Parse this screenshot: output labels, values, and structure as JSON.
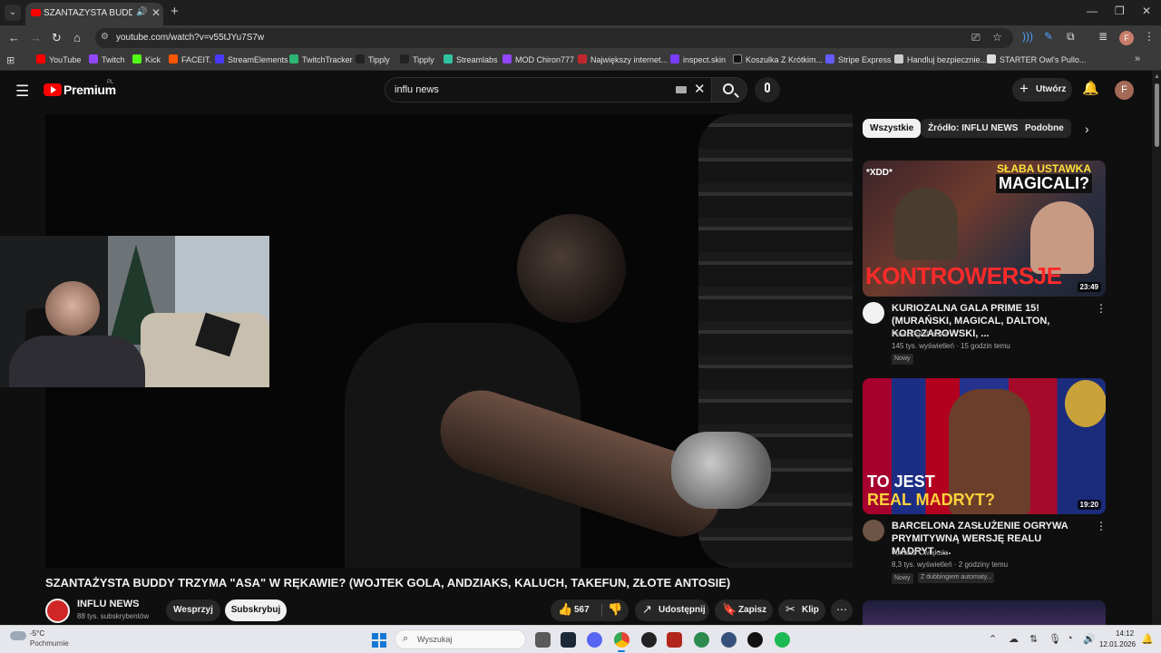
{
  "browser": {
    "tab_title": "SZANTAŻYSTA BUDDY TRZYM",
    "url": "youtube.com/watch?v=v55tJYu7S7w",
    "bookmarks": [
      {
        "label": "YouTube",
        "color": "#ff0000"
      },
      {
        "label": "Twitch",
        "color": "#9146ff"
      },
      {
        "label": "Kick",
        "color": "#53fc18"
      },
      {
        "label": "FACEIT.",
        "color": "#ff5500"
      },
      {
        "label": "StreamElements",
        "color": "#4a3aff"
      },
      {
        "label": "TwitchTracker",
        "color": "#2bb673"
      },
      {
        "label": "Tipply",
        "color": "#222222"
      },
      {
        "label": "Tipply",
        "color": "#222222"
      },
      {
        "label": "Streamlabs",
        "color": "#31c3a2"
      },
      {
        "label": "MOD Chiron777",
        "color": "#9146ff"
      },
      {
        "label": "Największy internet...",
        "color": "#c1272d"
      },
      {
        "label": "inspect.skin",
        "color": "#7a3cff"
      },
      {
        "label": "Koszulka Z Krótkim...",
        "color": "#111111"
      },
      {
        "label": "Stripe Express",
        "color": "#635bff"
      },
      {
        "label": "Handluj bezpiecznie...",
        "color": "#cccccc"
      },
      {
        "label": "STARTER Owl's Pullo...",
        "color": "#dddddd"
      }
    ]
  },
  "youtube": {
    "brand": "Premium",
    "region": "PL",
    "search_value": "influ news",
    "create_label": "Utwórz",
    "avatar_letter": "F"
  },
  "video": {
    "title": "SZANTAŻYSTA BUDDY TRZYMA \"ASA\" W RĘKAWIE? (WOJTEK GOLA, ANDZIAKS, KALUCH, TAKEFUN, ZŁOTE ANTOSIE)",
    "channel": "INFLU NEWS",
    "subscribers": "88 tys. subskrybentów",
    "support_label": "Wesprzyj",
    "subscribe_label": "Subskrybuj",
    "likes": "567",
    "share_label": "Udostępnij",
    "save_label": "Zapisz",
    "clip_label": "Klip"
  },
  "sidebar": {
    "chips": [
      "Wszystkie",
      "Źródło: INFLU NEWS",
      "Podobne"
    ],
    "recommendations": [
      {
        "thumb_texts": [
          "*XDD*",
          "SŁABA USTAWKA",
          "MAGICALI?",
          "KONTROWERSJE"
        ],
        "duration": "23:49",
        "title": "KURIOZALNA GALA PRIME 15! (MURAŃSKI, MAGICAL, DALTON, KORCZAROWSKI, ...",
        "channel": "FreakFightPolska",
        "meta": "145 tys. wyświetleń · 15 godzin temu",
        "badges": [
          "Nowy"
        ]
      },
      {
        "thumb_texts": [
          "TO JEST",
          "REAL MADRYT?"
        ],
        "duration": "19:20",
        "title": "BARCELONA ZASŁUŻENIE OGRYWA PRYMITYWNĄ WERSJĘ REALU MADRYT - ...",
        "channel": "Tomasz Ćwiąkała",
        "meta": "8,3 tys. wyświetleń · 2 godziny temu",
        "badges": [
          "Nowy",
          "Z dubbingiem automaty..."
        ]
      }
    ]
  },
  "taskbar": {
    "temperature": "-5°C",
    "weather": "Pochmurnie",
    "search_placeholder": "Wyszukaj",
    "time": "14:12",
    "date": "12.01.2026"
  }
}
